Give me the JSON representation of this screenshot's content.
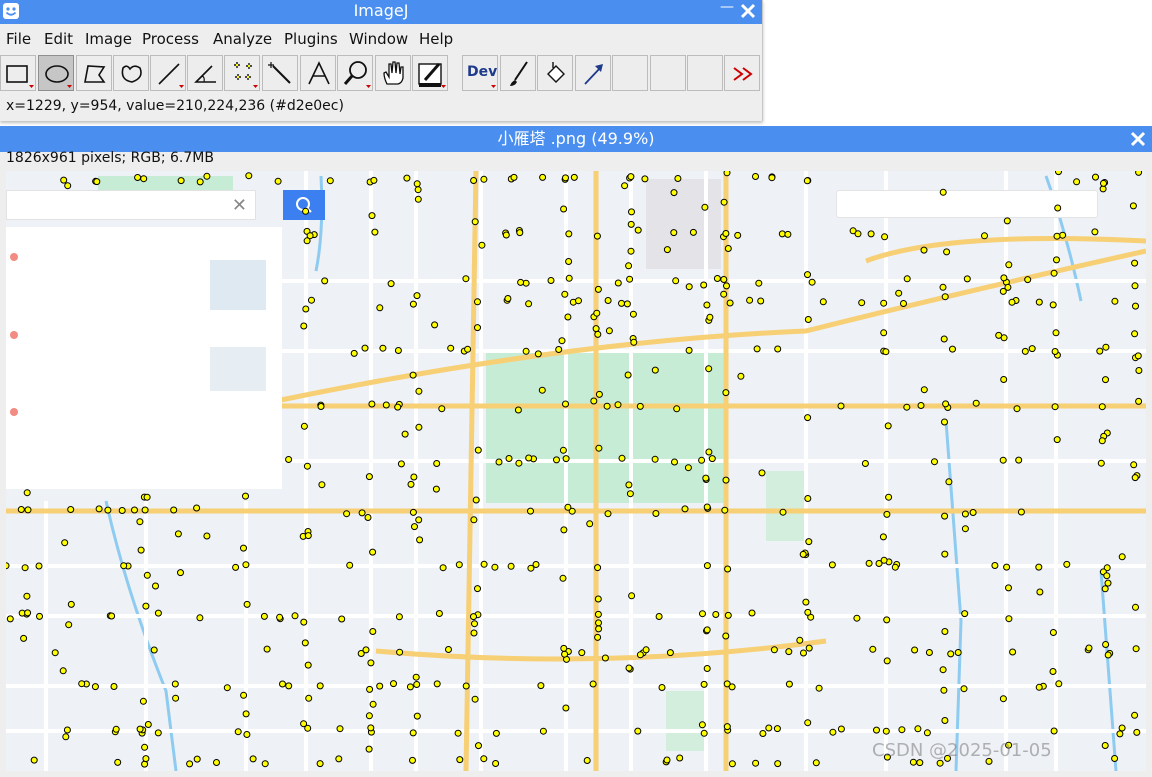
{
  "main_window": {
    "title": "ImageJ",
    "minimize_glyph": "—",
    "menu": [
      "File",
      "Edit",
      "Image",
      "Process",
      "Analyze",
      "Plugins",
      "Window",
      "Help"
    ],
    "tools": [
      {
        "name": "rectangle-tool-icon",
        "active": false
      },
      {
        "name": "oval-tool-icon",
        "active": true
      },
      {
        "name": "polygon-tool-icon",
        "active": false
      },
      {
        "name": "freehand-tool-icon",
        "active": false
      },
      {
        "name": "line-tool-icon",
        "active": false
      },
      {
        "name": "angle-tool-icon",
        "active": false
      },
      {
        "name": "multipoint-tool-icon",
        "active": false
      },
      {
        "name": "wand-tool-icon",
        "active": false
      },
      {
        "name": "text-tool-icon",
        "active": false
      },
      {
        "name": "magnifier-tool-icon",
        "active": false
      },
      {
        "name": "hand-tool-icon",
        "active": false
      },
      {
        "name": "color-picker-tool-icon",
        "active": false
      },
      {
        "name": "developer-menu",
        "label": "Dev"
      },
      {
        "name": "brush-tool-icon"
      },
      {
        "name": "flood-fill-tool-icon"
      },
      {
        "name": "arrow-tool-icon"
      },
      {
        "name": "empty-slot"
      },
      {
        "name": "empty-slot"
      },
      {
        "name": "empty-slot"
      },
      {
        "name": "more-tools-icon"
      }
    ],
    "status": "x=1229, y=954, value=210,224,236 (#d2e0ec)"
  },
  "image_window": {
    "title": "小雁塔 .png (49.9%)",
    "info": "1826x961 pixels; RGB; 6.7MB",
    "watermark": "CSDN @2025-01-05"
  },
  "colors": {
    "titlebar": "#4a8ff0",
    "point_fill": "#ffff00",
    "park_green": "#c7ecd6",
    "major_road": "#f7cf74",
    "map_bg": "#eef1f6"
  }
}
